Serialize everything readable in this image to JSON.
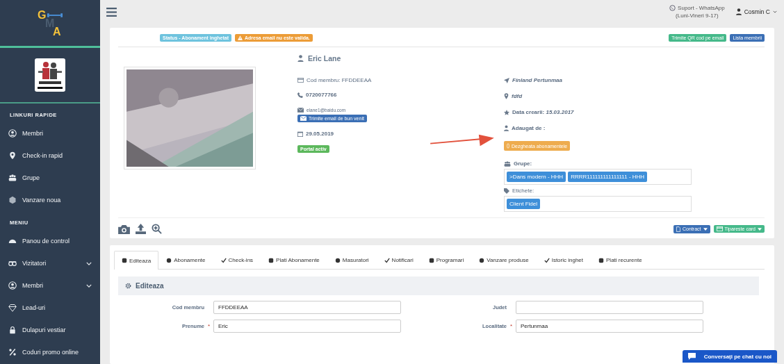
{
  "sidebar": {
    "logo": [
      "G",
      "M",
      "A"
    ],
    "sections": [
      {
        "title": "LINKURI RAPIDE",
        "items": [
          {
            "label": "Membri",
            "expandable": false
          },
          {
            "label": "Check-in rapid",
            "expandable": false
          },
          {
            "label": "Grupe",
            "expandable": false
          },
          {
            "label": "Vanzare noua",
            "expandable": false
          }
        ]
      },
      {
        "title": "MENIU",
        "items": [
          {
            "label": "Panou de control",
            "expandable": false
          },
          {
            "label": "Vizitatori",
            "expandable": true
          },
          {
            "label": "Membri",
            "expandable": true
          },
          {
            "label": "Lead-uri",
            "expandable": false
          },
          {
            "label": "Dulapuri vestiar",
            "expandable": false
          },
          {
            "label": "Coduri promo online",
            "expandable": false
          }
        ]
      }
    ]
  },
  "topbar": {
    "support": "Suport - WhatsApp",
    "hours": "(Luni-Vineri 9-17)",
    "user": "Cosmin C"
  },
  "member": {
    "badges": [
      {
        "text": "Status - Abonament inghetat",
        "kind": "info"
      },
      {
        "text": "Adresa email nu este valida.",
        "kind": "warning"
      }
    ],
    "actions": [
      "Trimite QR cod pe email",
      "Lista membrii"
    ],
    "name": "Eric Lane",
    "code": "Cod membru: FFDDEEAA",
    "phone": "0720077766",
    "email": "elane1@baidu.com",
    "welcome_button": "Trimite email de bun venit",
    "date": "29.05.2019",
    "portal": "Portal activ",
    "location": "Finland Pertunmaa",
    "address": "fdfd",
    "created_label": "Data crearii:",
    "created": "15.03.2017",
    "added_by": "Adaugat de :",
    "unfreeze": "Dezgheata abonamentele",
    "groups_label": "Grupe:",
    "groups": [
      ">Dans modern - HHH",
      "RRRR111111111111111 - HHH"
    ],
    "tags_label": "Etichete:",
    "tags": [
      "Client Fidel"
    ],
    "print_buttons": [
      "Contract",
      "Tipareste card"
    ]
  },
  "tabs": [
    {
      "label": "Editeaza",
      "selected": true
    },
    {
      "label": "Abonamente",
      "selected": false
    },
    {
      "label": "Check-ins",
      "selected": false
    },
    {
      "label": "Plati Abonamente",
      "selected": false
    },
    {
      "label": "Masuratori",
      "selected": false
    },
    {
      "label": "Notificari",
      "selected": false
    },
    {
      "label": "Programari",
      "selected": false
    },
    {
      "label": "Vanzare produse",
      "selected": false
    },
    {
      "label": "Istoric inghet",
      "selected": false
    },
    {
      "label": "Plati recurente",
      "selected": false
    }
  ],
  "panel_title": "Editeaza",
  "required_mark": "*",
  "form": [
    {
      "label": "Cod membru",
      "required": false,
      "value": "FFDDEEAA"
    },
    {
      "label": "Judet",
      "required": false
    },
    {
      "label": "Prenume",
      "required": true,
      "value": "Eric"
    },
    {
      "label": "Localitate",
      "required": true,
      "value": "Pertunmaa"
    }
  ],
  "chat": "Conversați pe chat cu noi"
}
